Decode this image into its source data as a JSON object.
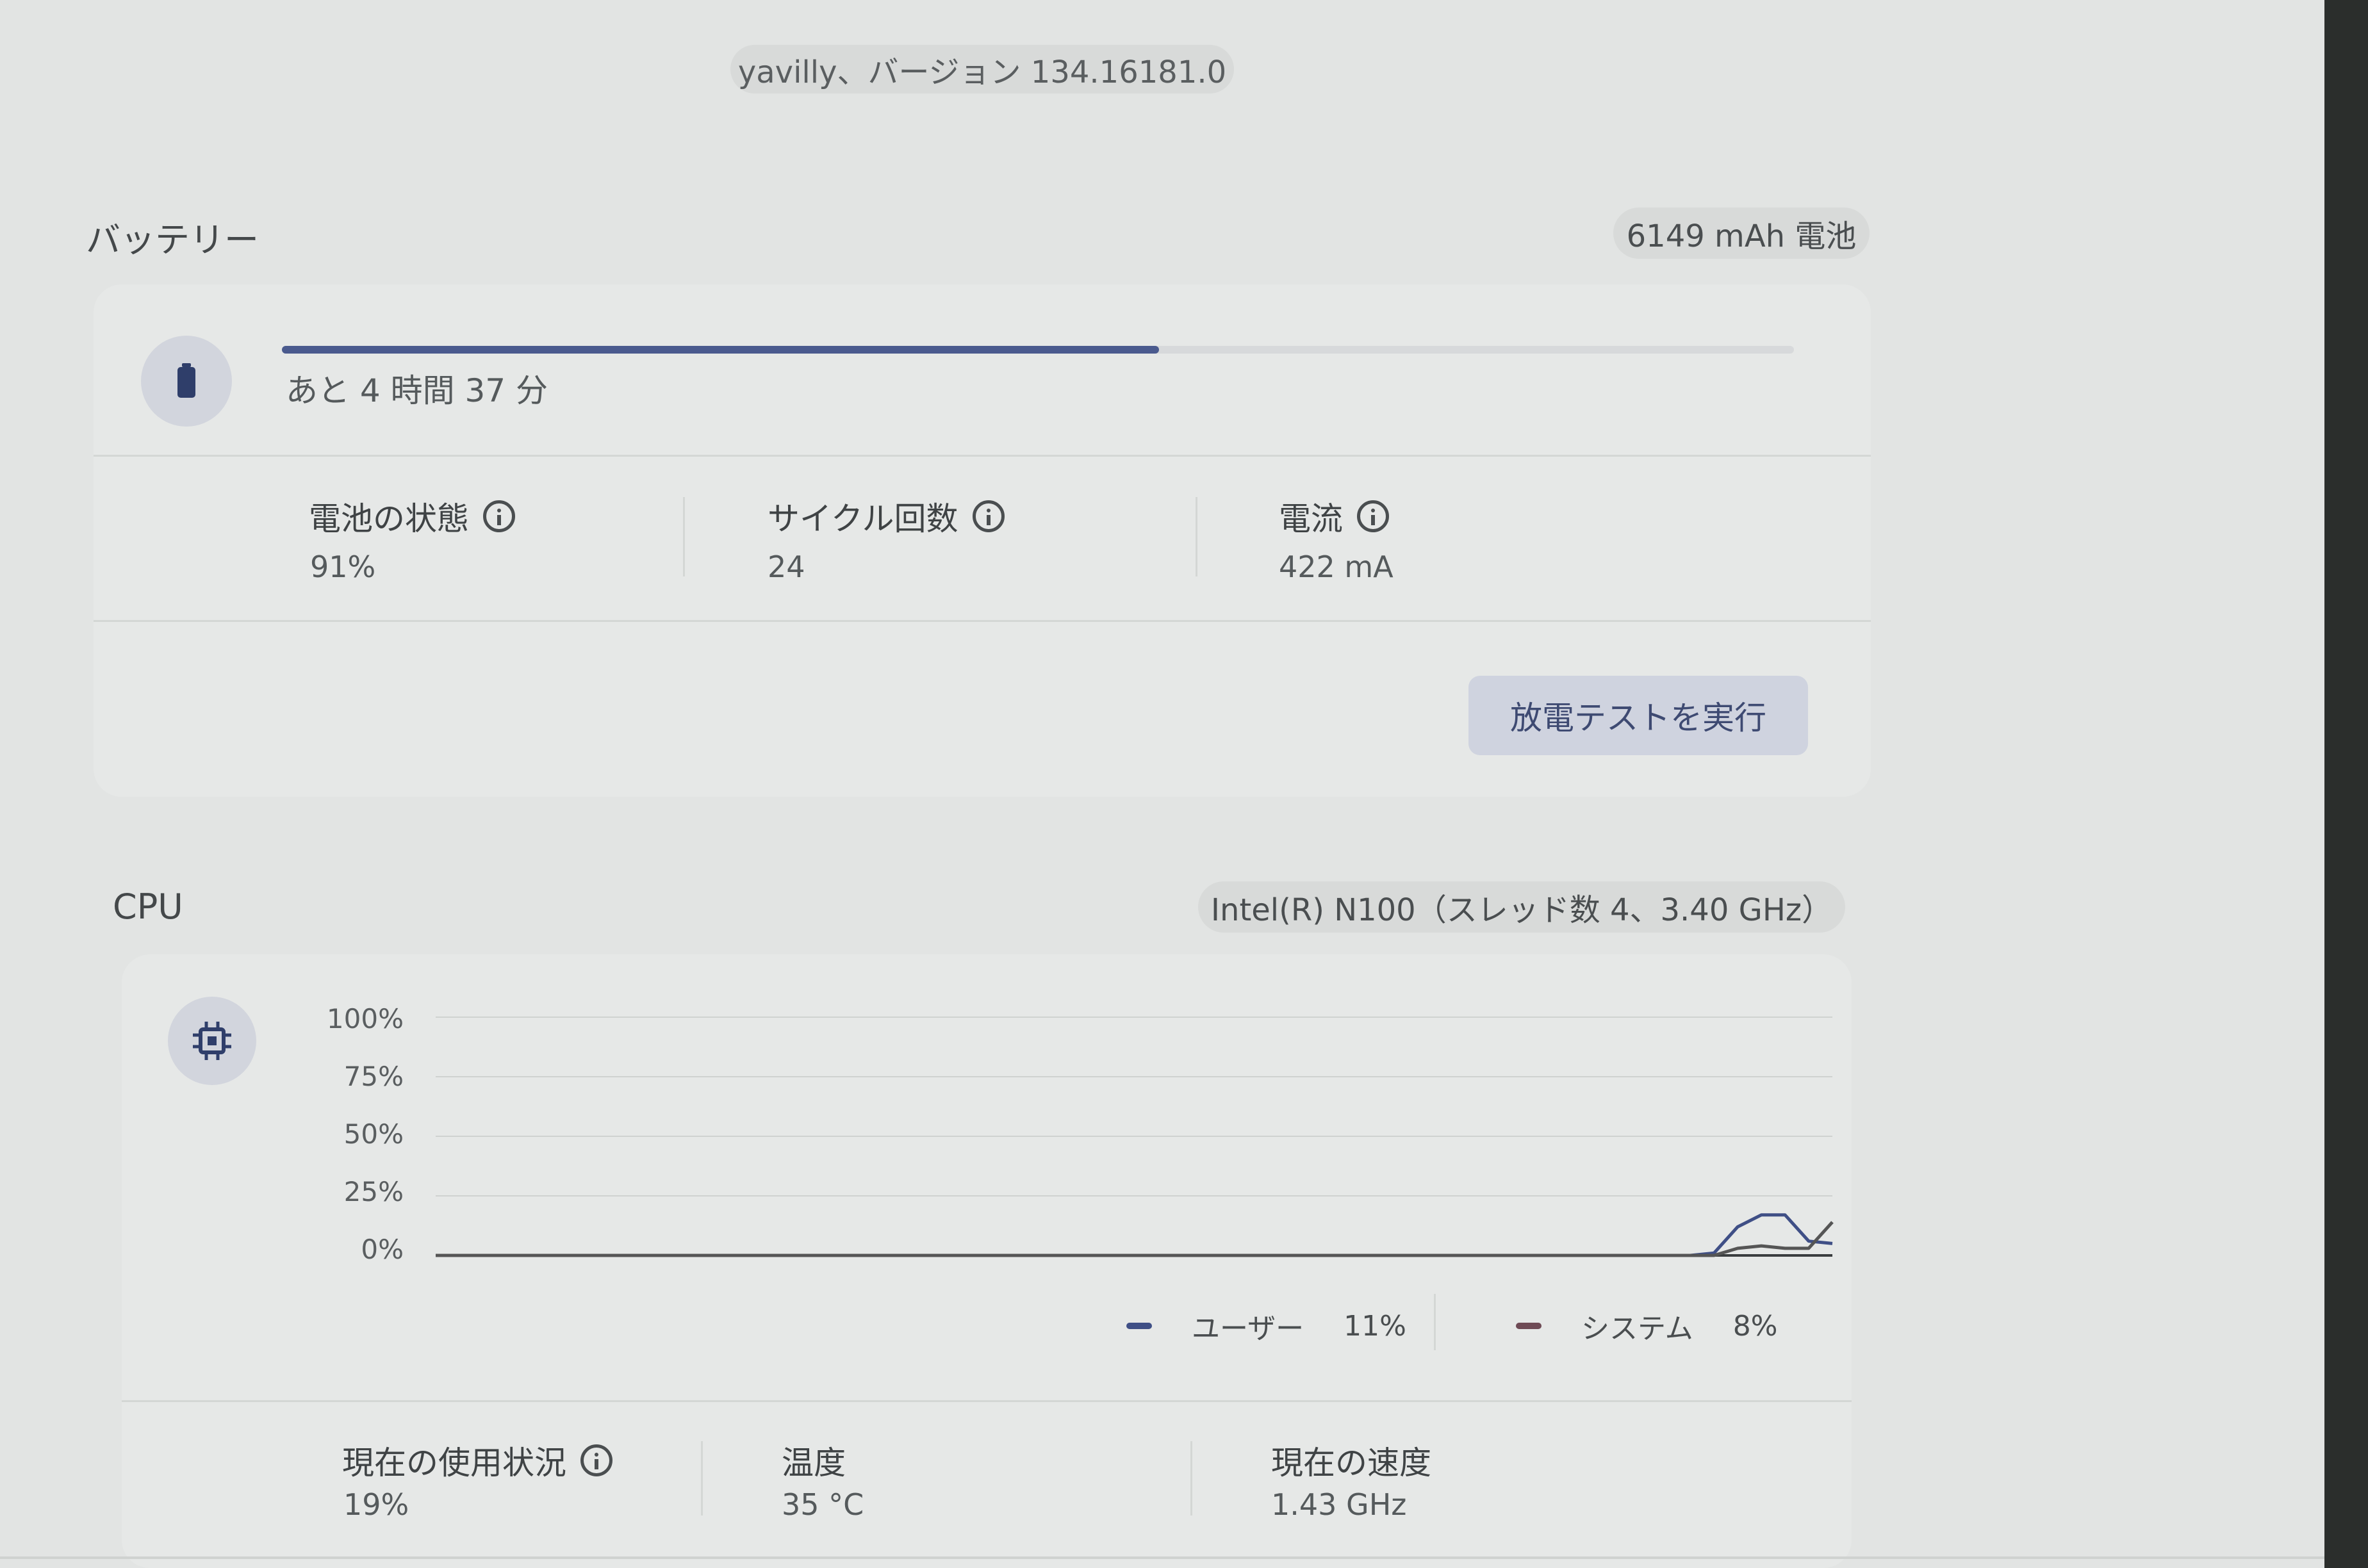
{
  "header": {
    "version_text": "yavilly、バージョン 134.16181.0"
  },
  "battery": {
    "title": "バッテリー",
    "capacity_chip": "6149 mAh 電池",
    "icon": "battery-icon",
    "charge_fraction": 0.58,
    "time_remaining": "あと 4 時間 37 分",
    "stats": [
      {
        "label": "電池の状態",
        "value": "91%",
        "info": true
      },
      {
        "label": "サイクル回数",
        "value": "24",
        "info": true
      },
      {
        "label": "電流",
        "value": "422 mA",
        "info": true
      }
    ],
    "discharge_button": "放電テストを実行"
  },
  "cpu": {
    "title": "CPU",
    "model_chip": "Intel(R) N100（スレッド数 4、3.40 GHz）",
    "icon": "cpu-icon",
    "legend": [
      {
        "name": "ユーザー",
        "value": "11%",
        "color": "#3f4f86"
      },
      {
        "name": "システム",
        "value": "8%",
        "color": "#6e4a55"
      }
    ],
    "stats": [
      {
        "label": "現在の使用状況",
        "value": "19%",
        "info": true
      },
      {
        "label": "温度",
        "value": "35 °C",
        "info": false
      },
      {
        "label": "現在の速度",
        "value": "1.43 GHz",
        "info": false
      }
    ]
  },
  "chart_data": {
    "type": "line",
    "y_ticks": [
      "100%",
      "75%",
      "50%",
      "25%",
      "0%"
    ],
    "ylim": [
      0,
      100
    ],
    "x": [
      0,
      1,
      2,
      3,
      4,
      5,
      6,
      7,
      8,
      9,
      10,
      11,
      12,
      13,
      14,
      15,
      16,
      17,
      18,
      19,
      20,
      21,
      22,
      23,
      24,
      25,
      26,
      27,
      28,
      29,
      30,
      31,
      32,
      33,
      34,
      35,
      36,
      37,
      38,
      39,
      40,
      41,
      42,
      43,
      44,
      45,
      46,
      47,
      48,
      49,
      50,
      51,
      52,
      53,
      54,
      55,
      56,
      57,
      58,
      59
    ],
    "series": [
      {
        "name": "ユーザー",
        "color": "#3f4f86",
        "values": [
          0,
          0,
          0,
          0,
          0,
          0,
          0,
          0,
          0,
          0,
          0,
          0,
          0,
          0,
          0,
          0,
          0,
          0,
          0,
          0,
          0,
          0,
          0,
          0,
          0,
          0,
          0,
          0,
          0,
          0,
          0,
          0,
          0,
          0,
          0,
          0,
          0,
          0,
          0,
          0,
          0,
          0,
          0,
          0,
          0,
          0,
          0,
          0,
          0,
          0,
          0,
          0,
          0,
          0,
          1,
          12,
          17,
          17,
          6,
          5
        ]
      },
      {
        "name": "システム",
        "color": "#555555",
        "values": [
          0,
          0,
          0,
          0,
          0,
          0,
          0,
          0,
          0,
          0,
          0,
          0,
          0,
          0,
          0,
          0,
          0,
          0,
          0,
          0,
          0,
          0,
          0,
          0,
          0,
          0,
          0,
          0,
          0,
          0,
          0,
          0,
          0,
          0,
          0,
          0,
          0,
          0,
          0,
          0,
          0,
          0,
          0,
          0,
          0,
          0,
          0,
          0,
          0,
          0,
          0,
          0,
          0,
          0,
          0,
          3,
          4,
          3,
          3,
          14
        ]
      }
    ]
  }
}
